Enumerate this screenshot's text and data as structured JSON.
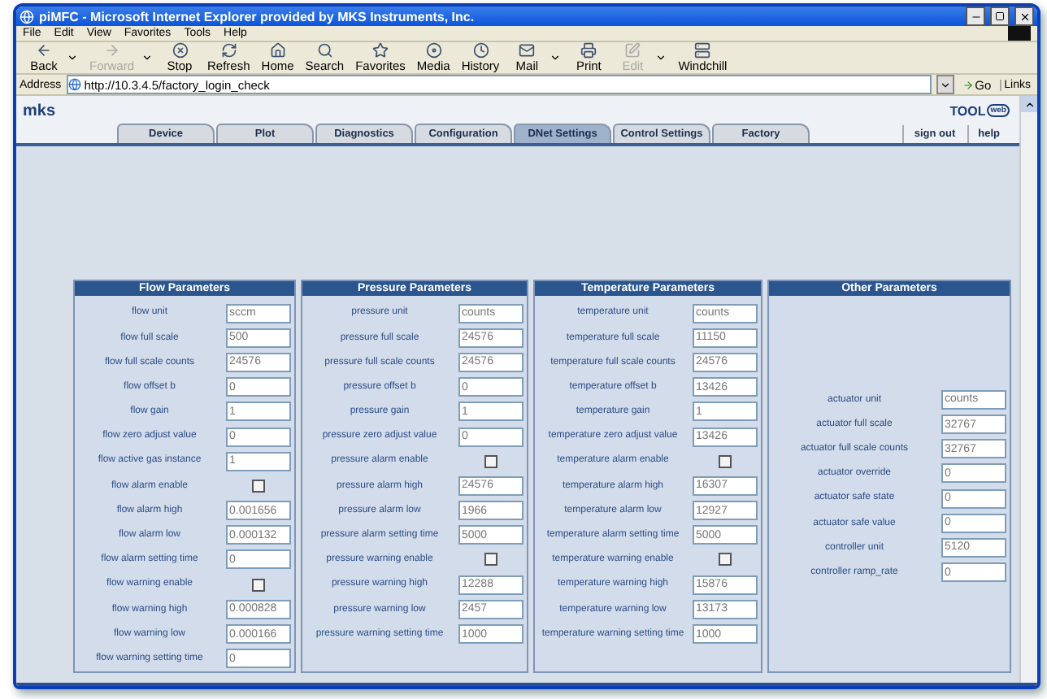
{
  "window": {
    "title": "piMFC - Microsoft Internet Explorer provided by MKS Instruments, Inc."
  },
  "menu": [
    "File",
    "Edit",
    "View",
    "Favorites",
    "Tools",
    "Help"
  ],
  "toolbar": [
    {
      "label": "Back",
      "dropdown": true,
      "disabled": false
    },
    {
      "label": "Forward",
      "dropdown": true,
      "disabled": true
    },
    {
      "label": "Stop",
      "dropdown": false,
      "disabled": false
    },
    {
      "label": "Refresh",
      "dropdown": false,
      "disabled": false
    },
    {
      "label": "Home",
      "dropdown": false,
      "disabled": false
    },
    {
      "label": "Search",
      "dropdown": false,
      "disabled": false
    },
    {
      "label": "Favorites",
      "dropdown": false,
      "disabled": false
    },
    {
      "label": "Media",
      "dropdown": false,
      "disabled": false
    },
    {
      "label": "History",
      "dropdown": false,
      "disabled": false
    },
    {
      "label": "Mail",
      "dropdown": true,
      "disabled": false
    },
    {
      "label": "Print",
      "dropdown": false,
      "disabled": false
    },
    {
      "label": "Edit",
      "dropdown": true,
      "disabled": true
    },
    {
      "label": "Windchill",
      "dropdown": false,
      "disabled": false
    }
  ],
  "address": {
    "label": "Address",
    "url": "http://10.3.4.5/factory_login_check",
    "go": "Go",
    "links": "Links"
  },
  "page": {
    "logo": "mks",
    "toolweb_logo": {
      "text": "TOOL",
      "badge": "web"
    },
    "tabs": [
      {
        "label": "Device",
        "selected": false
      },
      {
        "label": "Plot",
        "selected": false
      },
      {
        "label": "Diagnostics",
        "selected": false
      },
      {
        "label": "Configuration",
        "selected": false
      },
      {
        "label": "DNet Settings",
        "selected": true
      },
      {
        "label": "Control Settings",
        "selected": false
      },
      {
        "label": "Factory",
        "selected": false
      }
    ],
    "links": [
      "sign out",
      "help"
    ]
  },
  "panels": [
    {
      "title": "Flow Parameters",
      "rows": [
        {
          "kind": "field",
          "label": "flow unit",
          "value": "sccm"
        },
        {
          "kind": "field",
          "label": "flow full scale",
          "value": "500"
        },
        {
          "kind": "field",
          "label": "flow full scale counts",
          "value": "24576"
        },
        {
          "kind": "field",
          "label": "flow offset b",
          "value": "0"
        },
        {
          "kind": "field",
          "label": "flow gain",
          "value": "1"
        },
        {
          "kind": "field",
          "label": "flow zero adjust value",
          "value": "0"
        },
        {
          "kind": "field",
          "label": "flow active gas instance",
          "value": "1"
        },
        {
          "kind": "checkbox",
          "label": "flow alarm enable",
          "checked": false
        },
        {
          "kind": "field",
          "label": "flow alarm high",
          "value": "0.001656"
        },
        {
          "kind": "field",
          "label": "flow alarm low",
          "value": "0.000132"
        },
        {
          "kind": "field",
          "label": "flow alarm setting time",
          "value": "0"
        },
        {
          "kind": "checkbox",
          "label": "flow warning enable",
          "checked": false
        },
        {
          "kind": "field",
          "label": "flow warning high",
          "value": "0.000828"
        },
        {
          "kind": "field",
          "label": "flow warning low",
          "value": "0.000166"
        },
        {
          "kind": "field",
          "label": "flow warning setting time",
          "value": "0"
        }
      ]
    },
    {
      "title": "Pressure Parameters",
      "rows": [
        {
          "kind": "field",
          "label": "pressure unit",
          "value": "counts"
        },
        {
          "kind": "field",
          "label": "pressure full scale",
          "value": "24576"
        },
        {
          "kind": "field",
          "label": "pressure full scale counts",
          "value": "24576"
        },
        {
          "kind": "field",
          "label": "pressure offset b",
          "value": "0"
        },
        {
          "kind": "field",
          "label": "pressure gain",
          "value": "1"
        },
        {
          "kind": "field",
          "label": "pressure zero adjust value",
          "value": "0"
        },
        {
          "kind": "checkbox",
          "label": "pressure alarm enable",
          "checked": false
        },
        {
          "kind": "field",
          "label": "pressure alarm high",
          "value": "24576"
        },
        {
          "kind": "field",
          "label": "pressure alarm low",
          "value": "1966"
        },
        {
          "kind": "field",
          "label": "pressure alarm setting time",
          "value": "5000"
        },
        {
          "kind": "checkbox",
          "label": "pressure warning enable",
          "checked": false
        },
        {
          "kind": "field",
          "label": "pressure warning high",
          "value": "12288"
        },
        {
          "kind": "field",
          "label": "pressure warning low",
          "value": "2457"
        },
        {
          "kind": "field",
          "label": "pressure warning setting time",
          "value": "1000"
        }
      ]
    },
    {
      "title": "Temperature Parameters",
      "rows": [
        {
          "kind": "field",
          "label": "temperature unit",
          "value": "counts"
        },
        {
          "kind": "field",
          "label": "temperature full scale",
          "value": "11150"
        },
        {
          "kind": "field",
          "label": "temperature full scale counts",
          "value": "24576"
        },
        {
          "kind": "field",
          "label": "temperature offset b",
          "value": "13426"
        },
        {
          "kind": "field",
          "label": "temperature gain",
          "value": "1"
        },
        {
          "kind": "field",
          "label": "temperature zero adjust value",
          "value": "13426"
        },
        {
          "kind": "checkbox",
          "label": "temperature alarm enable",
          "checked": false
        },
        {
          "kind": "field",
          "label": "temperature alarm high",
          "value": "16307"
        },
        {
          "kind": "field",
          "label": "temperature alarm low",
          "value": "12927"
        },
        {
          "kind": "field",
          "label": "temperature alarm setting time",
          "value": "5000"
        },
        {
          "kind": "checkbox",
          "label": "temperature warning enable",
          "checked": false
        },
        {
          "kind": "field",
          "label": "temperature warning high",
          "value": "15876"
        },
        {
          "kind": "field",
          "label": "temperature warning low",
          "value": "13173"
        },
        {
          "kind": "field",
          "label": "temperature warning setting time",
          "value": "1000"
        }
      ]
    },
    {
      "title": "Other Parameters",
      "rows": [
        {
          "kind": "field",
          "label": "actuator unit",
          "value": "counts"
        },
        {
          "kind": "field",
          "label": "actuator full scale",
          "value": "32767"
        },
        {
          "kind": "field",
          "label": "actuator full scale counts",
          "value": "32767"
        },
        {
          "kind": "field",
          "label": "actuator override",
          "value": "0"
        },
        {
          "kind": "field",
          "label": "actuator safe state",
          "value": "0"
        },
        {
          "kind": "field",
          "label": "actuator safe value",
          "value": "0"
        },
        {
          "kind": "field",
          "label": "controller unit",
          "value": "5120"
        },
        {
          "kind": "field",
          "label": "controller ramp_rate",
          "value": "0"
        }
      ]
    }
  ]
}
